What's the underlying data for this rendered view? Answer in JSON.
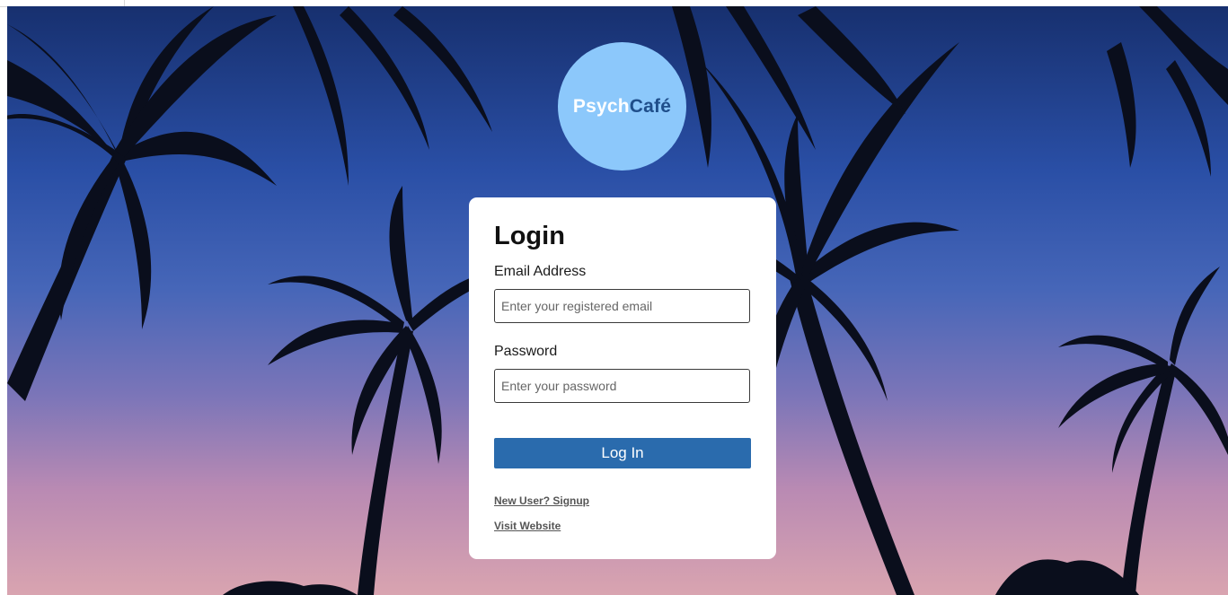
{
  "logo": {
    "part1": "Psych",
    "part2": "Café"
  },
  "login": {
    "title": "Login",
    "email_label": "Email Address",
    "email_placeholder": "Enter your registered email",
    "password_label": "Password",
    "password_placeholder": "Enter your password",
    "submit_label": "Log In"
  },
  "links": {
    "signup": "New User? Signup",
    "website": "Visit Website"
  },
  "colors": {
    "accent": "#2a6bad",
    "logo_bg": "#8cc8fb",
    "logo_dark": "#1f4e8a"
  }
}
